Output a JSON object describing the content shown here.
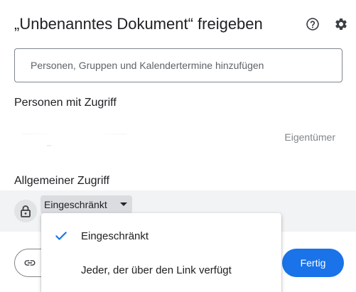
{
  "dialog": {
    "title": "„Unbenanntes Dokument“ freigeben"
  },
  "header": {
    "help_icon": "help-circle-icon",
    "settings_icon": "gear-icon"
  },
  "add_people": {
    "placeholder": "Personen, Gruppen und Kalendertermine hinzufügen",
    "value": ""
  },
  "people_with_access": {
    "heading": "Personen mit Zugriff",
    "people": [
      {
        "role": "Eigentümer"
      }
    ]
  },
  "general_access": {
    "heading": "Allgemeiner Zugriff",
    "lock_icon": "lock-icon",
    "selected": "Eingeschränkt"
  },
  "access_menu": {
    "items": [
      {
        "label": "Eingeschränkt",
        "checked": true
      },
      {
        "label": "Jeder, der über den Link verfügt",
        "checked": false
      }
    ]
  },
  "footer": {
    "copy_link_icon": "link-icon",
    "done_label": "Fertig"
  },
  "colors": {
    "accent": "#1a73e8",
    "band": "#f1f3f4",
    "text": "#202124",
    "muted": "#80868b"
  }
}
